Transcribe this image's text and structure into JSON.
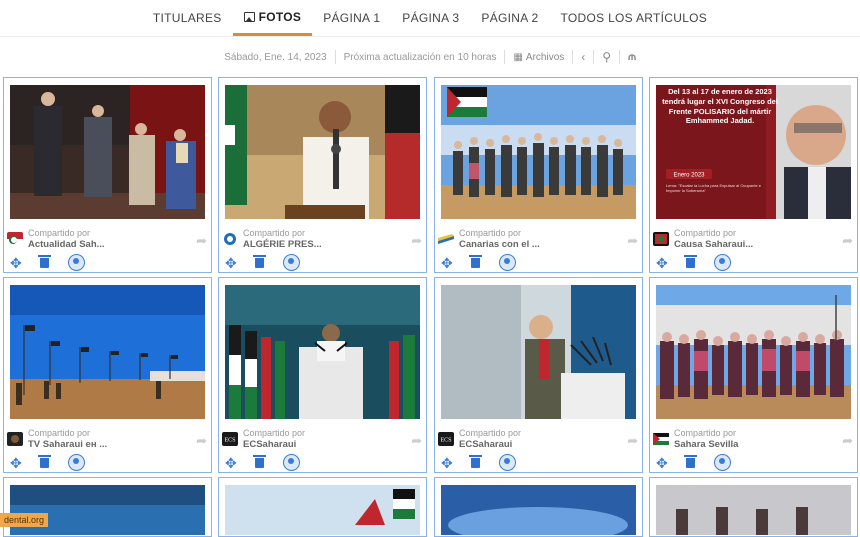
{
  "nav": {
    "tabs": [
      {
        "label": "TITULARES"
      },
      {
        "label": "FOTOS"
      },
      {
        "label": "PÁGINA 1"
      },
      {
        "label": "PÁGINA 3"
      },
      {
        "label": "PÁGINA 2"
      },
      {
        "label": "TODOS LOS ARTÍCULOS"
      }
    ],
    "active": "FOTOS"
  },
  "toolbar": {
    "date": "Sábado, Ene. 14, 2023",
    "next_update": "Próxima actualización en 10 horas",
    "archive": "Archivos"
  },
  "cards": [
    {
      "shared": "Compartido por",
      "source": "Actualidad Sah..."
    },
    {
      "shared": "Compartido por",
      "source": "ALGÉRIE PRES..."
    },
    {
      "shared": "Compartido por",
      "source": "Canarias con el ..."
    },
    {
      "shared": "Compartido por",
      "source": "Causa Saharaui..."
    },
    {
      "shared": "Compartido por",
      "source": "TV Saharaui ен ..."
    },
    {
      "shared": "Compartido por",
      "source": "ECSaharaui"
    },
    {
      "shared": "Compartido por",
      "source": "ECSaharaui"
    },
    {
      "shared": "Compartido por",
      "source": "Sahara Sevilla"
    }
  ],
  "poster": {
    "headline": "Del 13 al 17 de enero de 2023 tendrá lugar el XVI Congreso del Frente POLISARIO del mártir Emhammed Jadad.",
    "tag": "Enero 2023",
    "motto": "Lema: \"Escalar la Lucha para Expulsar al Ocupante e Imponer la Soberanía\""
  },
  "logo_text": "ECS",
  "watermark": "dental.org",
  "colors": {
    "accent": "#d98a3a",
    "card_border": "#8ab4e8",
    "action_blue": "#2f6fd0",
    "rss": "#e8562a"
  }
}
